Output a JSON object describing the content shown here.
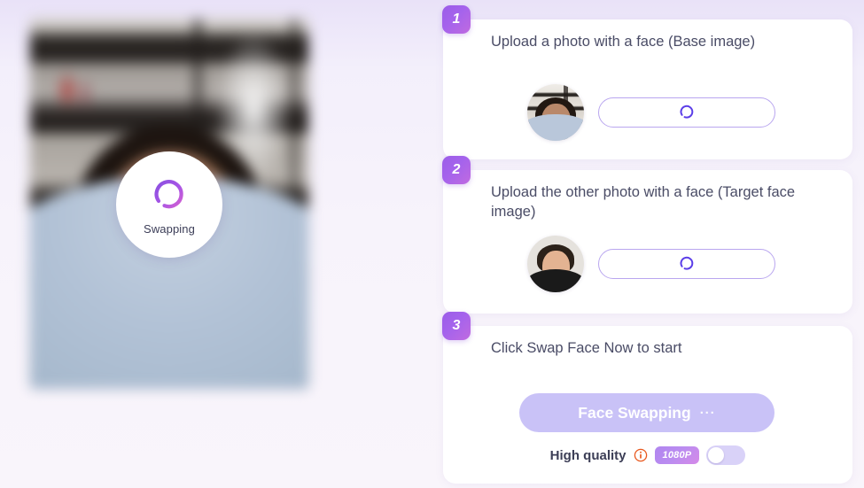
{
  "theme": {
    "accent_purple": "#9b5de8",
    "accent_magenta": "#c06ae0",
    "spinner_purple": "#5b3ee8",
    "disabled_button": "#c9c2f7",
    "text_dark": "#4a4c66",
    "background": "#f7f3fb"
  },
  "preview": {
    "status_label": "Swapping",
    "spinner_icon": "loading-spinner-icon",
    "photo_alt": "blurred preview photo of a person in a light blue shirt in front of bookshelves"
  },
  "steps": [
    {
      "number": "1",
      "title": "Upload a photo with a face (Base image)",
      "avatar_alt": "base image face thumbnail",
      "upload_button": {
        "label": "",
        "state": "loading",
        "icon": "loading-spinner-icon"
      }
    },
    {
      "number": "2",
      "title": "Upload the other photo with a face (Target face image)",
      "avatar_alt": "target face thumbnail",
      "upload_button": {
        "label": "",
        "state": "loading",
        "icon": "loading-spinner-icon"
      }
    },
    {
      "number": "3",
      "title": "Click Swap Face Now to start",
      "action_button": {
        "label": "Face Swapping",
        "trailing": "···",
        "state": "disabled"
      },
      "quality": {
        "label": "High quality",
        "info_icon": "info-circle-icon",
        "resolution_badge": "1080P",
        "toggle_state": "off"
      }
    }
  ]
}
